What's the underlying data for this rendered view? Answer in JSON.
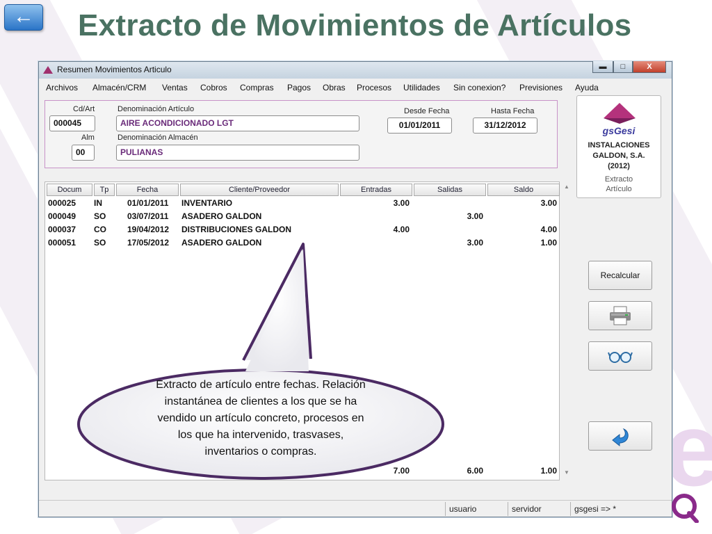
{
  "slide": {
    "title": "Extracto de Movimientos de Artículos",
    "back_glyph": "←"
  },
  "window": {
    "title": "Resumen Movimientos Articulo",
    "controls": {
      "minimize": "▬",
      "maximize": "□",
      "close": "X"
    }
  },
  "menu": [
    "Archivos",
    "Almacén/CRM",
    "Ventas",
    "Cobros",
    "Compras",
    "Pagos",
    "Obras",
    "Procesos",
    "Utilidades",
    "Sin conexion?",
    "Previsiones",
    "Ayuda"
  ],
  "form": {
    "cdart_label": "Cd/Art",
    "cdart_value": "000045",
    "denom_articulo_label": "Denominación Artículo",
    "denom_articulo_value": "AIRE ACONDICIONADO LGT",
    "alm_label": "Alm",
    "alm_value": "00",
    "denom_almacen_label": "Denominación Almacén",
    "denom_almacen_value": "PULIANAS",
    "desde_label": "Desde Fecha",
    "desde_value": "01/01/2011",
    "hasta_label": "Hasta Fecha",
    "hasta_value": "31/12/2012"
  },
  "company": {
    "brand": "gsGesi",
    "name_line1": "INSTALACIONES",
    "name_line2": "GALDON, S.A.",
    "name_line3": "(2012)",
    "screen_line1": "Extracto",
    "screen_line2": "Artículo"
  },
  "grid": {
    "headers": [
      "Docum",
      "Tp",
      "Fecha",
      "Cliente/Proveedor",
      "Entradas",
      "Salidas",
      "Saldo"
    ],
    "rows": [
      [
        "000025",
        "IN",
        "01/01/2011",
        "INVENTARIO",
        "3.00",
        "",
        "3.00"
      ],
      [
        "000049",
        "SO",
        "03/07/2011",
        "ASADERO GALDON",
        "",
        "3.00",
        ""
      ],
      [
        "000037",
        "CO",
        "19/04/2012",
        "DISTRIBUCIONES GALDON",
        "4.00",
        "",
        "4.00"
      ],
      [
        "000051",
        "SO",
        "17/05/2012",
        "ASADERO GALDON",
        "",
        "3.00",
        "1.00"
      ]
    ],
    "totals": {
      "entradas": "7.00",
      "salidas": "6.00",
      "saldo": "1.00"
    }
  },
  "buttons": {
    "recalcular": "Recalcular",
    "print_icon": "printer-icon",
    "view_icon": "glasses-icon",
    "return_icon": "return-arrow-icon"
  },
  "status": {
    "usuario": "usuario",
    "servidor": "servidor",
    "prompt": "gsgesi => *"
  },
  "callout": {
    "line1": "Extracto de artículo entre fechas. Relación",
    "line2": "instantánea de clientes  a los que se ha",
    "line3": "vendido un artículo concreto, procesos en",
    "line4": "los que ha intervenido, trasvases,",
    "line5": "inventarios o compras."
  },
  "colors": {
    "title": "#4a7262",
    "accent_purple": "#6a2b7a",
    "callout_border": "#4b2a63"
  }
}
